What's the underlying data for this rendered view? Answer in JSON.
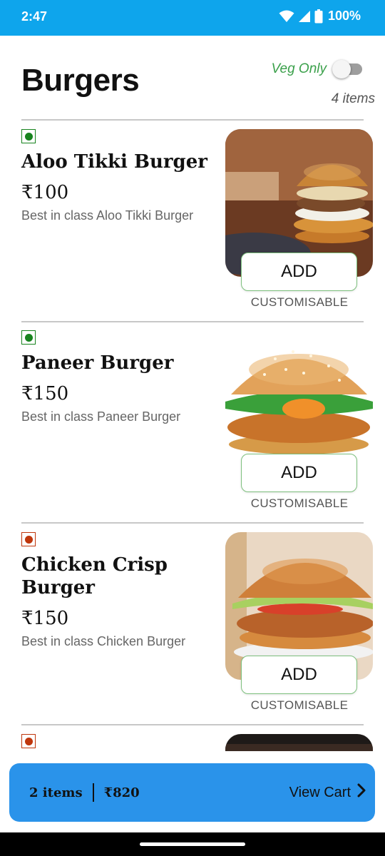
{
  "status_bar": {
    "time": "2:47",
    "battery": "100%"
  },
  "header": {
    "title": "Burgers",
    "veg_only_label": "Veg Only",
    "veg_only_enabled": false,
    "item_count": "4 items"
  },
  "items": [
    {
      "type": "veg",
      "name": "Aloo Tikki Burger",
      "price": "₹100",
      "description": "Best in class Aloo Tikki Burger",
      "add_label": "ADD",
      "customisable_label": "CUSTOMISABLE"
    },
    {
      "type": "veg",
      "name": "Paneer Burger",
      "price": "₹150",
      "description": "Best in class Paneer Burger",
      "add_label": "ADD",
      "customisable_label": "CUSTOMISABLE"
    },
    {
      "type": "non-veg",
      "name": "Chicken Crisp Burger",
      "price": "₹150",
      "description": "Best in class Chicken Burger",
      "add_label": "ADD",
      "customisable_label": "CUSTOMISABLE"
    },
    {
      "type": "non-veg"
    }
  ],
  "cart": {
    "items_label": "2 items",
    "total": "₹820",
    "view_label": "View Cart"
  },
  "colors": {
    "status_bar": "#0ea5ec",
    "veg": "#17831e",
    "non_veg": "#bf360c",
    "cart_bar": "#2a93ea",
    "veg_label": "#3aa04a"
  }
}
